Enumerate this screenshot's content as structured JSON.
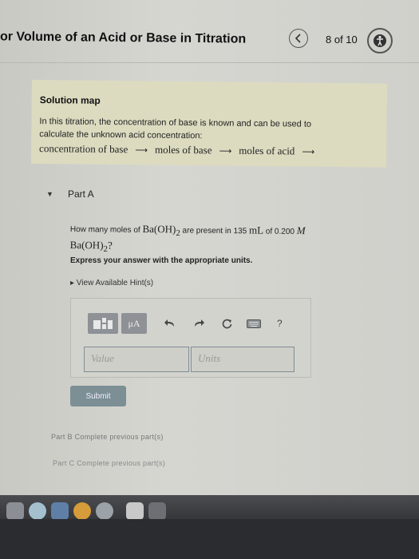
{
  "header": {
    "title": "or Volume of an Acid or Base in Titration",
    "page_counter": "8 of 10"
  },
  "solution_map": {
    "title": "Solution map",
    "line1": "In this titration, the concentration of base is known and can be used to",
    "line2": "calculate the unknown acid concentration:",
    "chain": [
      "concentration of base",
      "moles of base",
      "moles of acid"
    ],
    "arrow": "⟶"
  },
  "part_a": {
    "toggle": "▼",
    "label": "Part A",
    "question_pre": "How many moles of",
    "compound": "Ba(OH)",
    "subscript": "2",
    "question_mid": "are present in 135",
    "unit_ml": "mL",
    "question_of": "of 0.200",
    "unit_m": "M",
    "compound2": "Ba(OH)",
    "subscript2": "2",
    "question_end": "?",
    "instructions": "Express your answer with the appropriate units.",
    "hints": "▸  View Available Hint(s)",
    "mu_label": "μA",
    "value_placeholder": "Value",
    "units_placeholder": "Units",
    "submit": "Submit"
  },
  "part_b": "Part B   Complete previous part(s)",
  "part_c": "Part C   Complete previous part(s)",
  "colors": {
    "accent": "#7b8f94",
    "solution_bg": "#dcdbc0"
  }
}
